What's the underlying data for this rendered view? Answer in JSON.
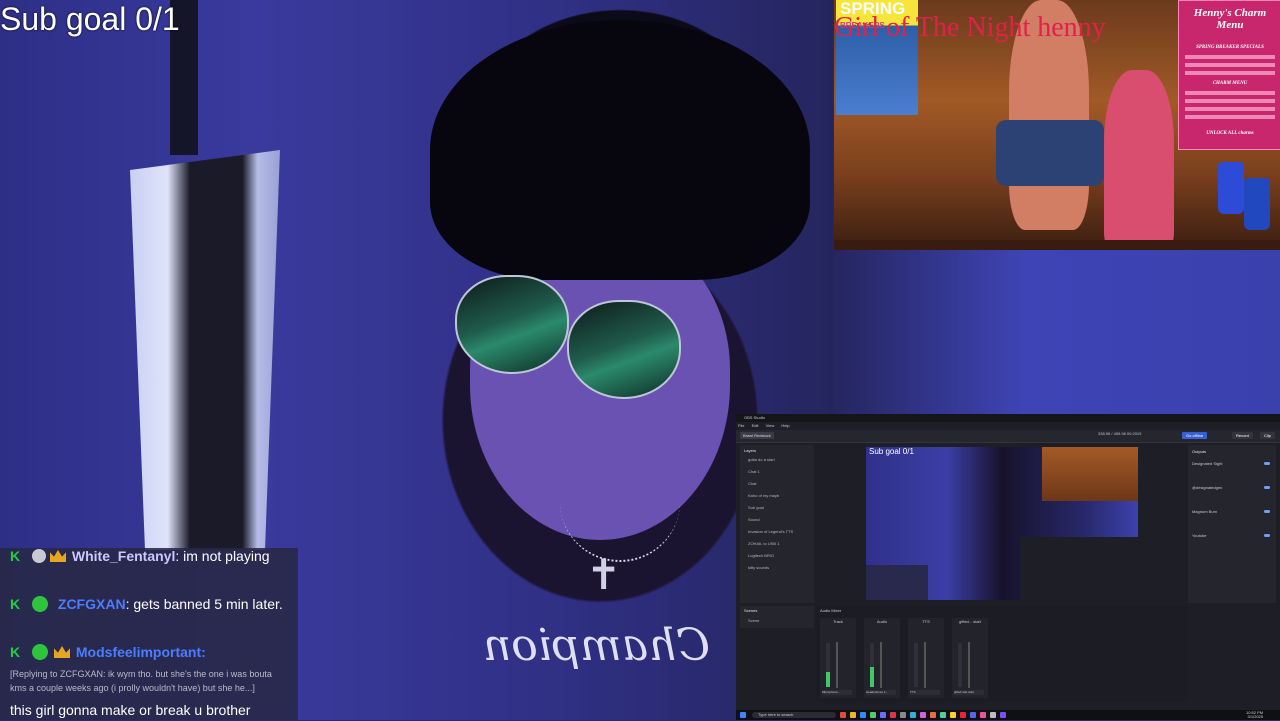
{
  "overlay": {
    "sub_goal": "Sub goal 0/1"
  },
  "stream_preview": {
    "title": "Girl of The Night  henny",
    "spring_label": "SPRING",
    "spring_sub": "BREAKERS",
    "charm_menu_title": "Henny's Charm Menu",
    "charm_specials": "SPRING BREAKER SPECIALS",
    "charm_menu_label": "CHARM MENU",
    "charm_unlock": "UNLOCK ALL charms"
  },
  "chat": {
    "messages": [
      {
        "user": "White_Fentanyl",
        "text": "im not playing"
      },
      {
        "user": "ZCFGXAN",
        "text": "gets banned 5 min later."
      },
      {
        "user": "Modsfeelimportant",
        "reply_note": "[Replying to ZCFGXAN: ik wym tho. but she's the one i was bouta kms a couple weeks ago (i prolly wouldn't have) but she he...]",
        "text": "this girl gonna make or break u brother"
      }
    ]
  },
  "obs": {
    "window_title": "OBS Studio",
    "menu": [
      "File",
      "Edit",
      "View",
      "Help"
    ],
    "scene_button": "Brawl Redstock",
    "stats": "338.96 / 495.98  00:2019",
    "btn_go_offline": "Go offline",
    "btn_record": "Record",
    "btn_clip": "Clip",
    "layers_title": "Layers",
    "layers": [
      "gotta do a start",
      "Chat 1",
      "Chat",
      "Kaho of my mayb",
      "Sub goal",
      "Sound",
      "Invasion of Legend's TTS",
      "ZOHAIL to USB 1",
      "Logitech BRIO",
      "kitty sounds"
    ],
    "scenes_title": "Scenes",
    "scenes": [
      "Scene"
    ],
    "outputs_title": "Outputs",
    "outputs": [
      "Designated Sight",
      "@designatedgen",
      "Magnum Burn",
      "Youtube"
    ],
    "mixer_title": "Audio Mixer",
    "channels": [
      {
        "name": "Track",
        "level": 0.35
      },
      {
        "name": "Audio",
        "level": 0.45
      },
      {
        "name": "TTS",
        "level": 0.0
      },
      {
        "name": "gifted... start",
        "level": 0.0
      }
    ],
    "channel_selects": [
      "Microphone...",
      "Headphones 1...",
      "TTS",
      "gifted rate start"
    ],
    "taskbar_search": "Type here to search",
    "clock_time": "10:52 PM",
    "clock_date": "3/1/2025"
  },
  "colors": {
    "chat_badge_k": "#1dd33c",
    "chat_username": "#4a7dff",
    "stream_title": "#e0224a"
  }
}
